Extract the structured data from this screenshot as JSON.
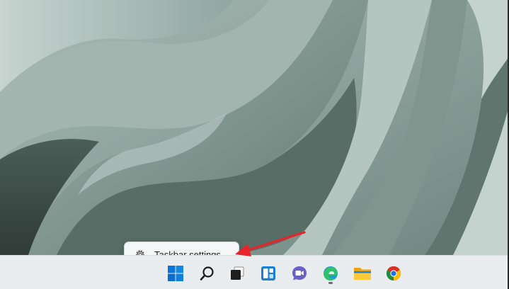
{
  "desktop": {
    "wallpaper": "Windows 11 bloom wallpaper (sage green)"
  },
  "context_menu": {
    "items": [
      {
        "label": "Taskbar settings",
        "icon": "gear-icon"
      }
    ]
  },
  "taskbar": {
    "apps": [
      {
        "name": "start",
        "icon": "windows-logo-icon"
      },
      {
        "name": "search",
        "icon": "search-icon"
      },
      {
        "name": "task-view",
        "icon": "task-view-icon"
      },
      {
        "name": "widgets",
        "icon": "widgets-icon"
      },
      {
        "name": "teams-chat",
        "icon": "chat-icon"
      },
      {
        "name": "edge",
        "icon": "edge-icon",
        "running": true
      },
      {
        "name": "file-explorer",
        "icon": "folder-icon"
      },
      {
        "name": "chrome",
        "icon": "chrome-icon"
      }
    ]
  },
  "colors": {
    "annotation_arrow": "#e8232a",
    "taskbar_bg": "#e9edef",
    "menu_bg": "#f5f6f7",
    "windows_blue": "#0a74d8"
  }
}
